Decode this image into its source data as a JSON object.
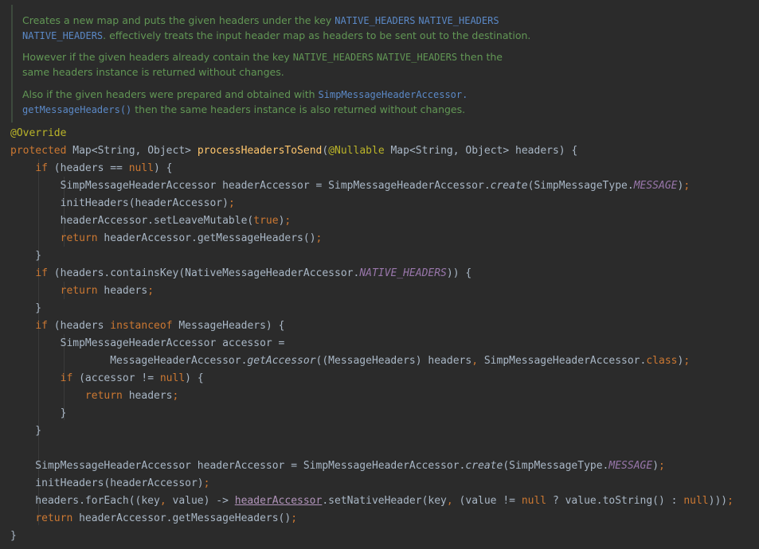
{
  "doc": {
    "p1_l1_text": "Creates a new map and puts the given headers under the key ",
    "p1_l1_ref1": "NATIVE_HEADERS",
    "p1_l1_ref2": "NATIVE_HEADERS",
    "p1_l2_ref": "NATIVE_HEADERS",
    "p1_l2_text": ". effectively treats the input header map as headers to be sent out to the destination.",
    "p2_l1_text": "However if the given headers already contain the key ",
    "p2_l1_ref1": "NATIVE_HEADERS",
    "p2_l1_ref2": "NATIVE_HEADERS",
    "p2_l1_tail": " then the",
    "p2_l2_text": "same headers instance is returned without changes.",
    "p3_l1_text": "Also if the given headers were prepared and obtained with ",
    "p3_l1_ref": "SimpMessageHeaderAccessor.",
    "p3_l2_ref": "getMessageHeaders()",
    "p3_l2_text": " then the same headers instance is also returned without changes."
  },
  "code": {
    "annotation": "@Override",
    "kw_protected": "protected",
    "sig_type": "Map<String, Object>",
    "method_name": "processHeadersToSend",
    "param_ann": "@Nullable",
    "param_rest": "Map<String, Object> headers) {",
    "kw_if": "if",
    "kw_null": "null",
    "kw_true": "true",
    "kw_return": "return",
    "kw_instanceof": "instanceof",
    "kw_class": "class",
    "const_message": "MESSAGE",
    "const_native_headers": "NATIVE_HEADERS",
    "m_create": "create",
    "m_getAccessor": "getAccessor",
    "underlined_var": "headerAccessor"
  }
}
